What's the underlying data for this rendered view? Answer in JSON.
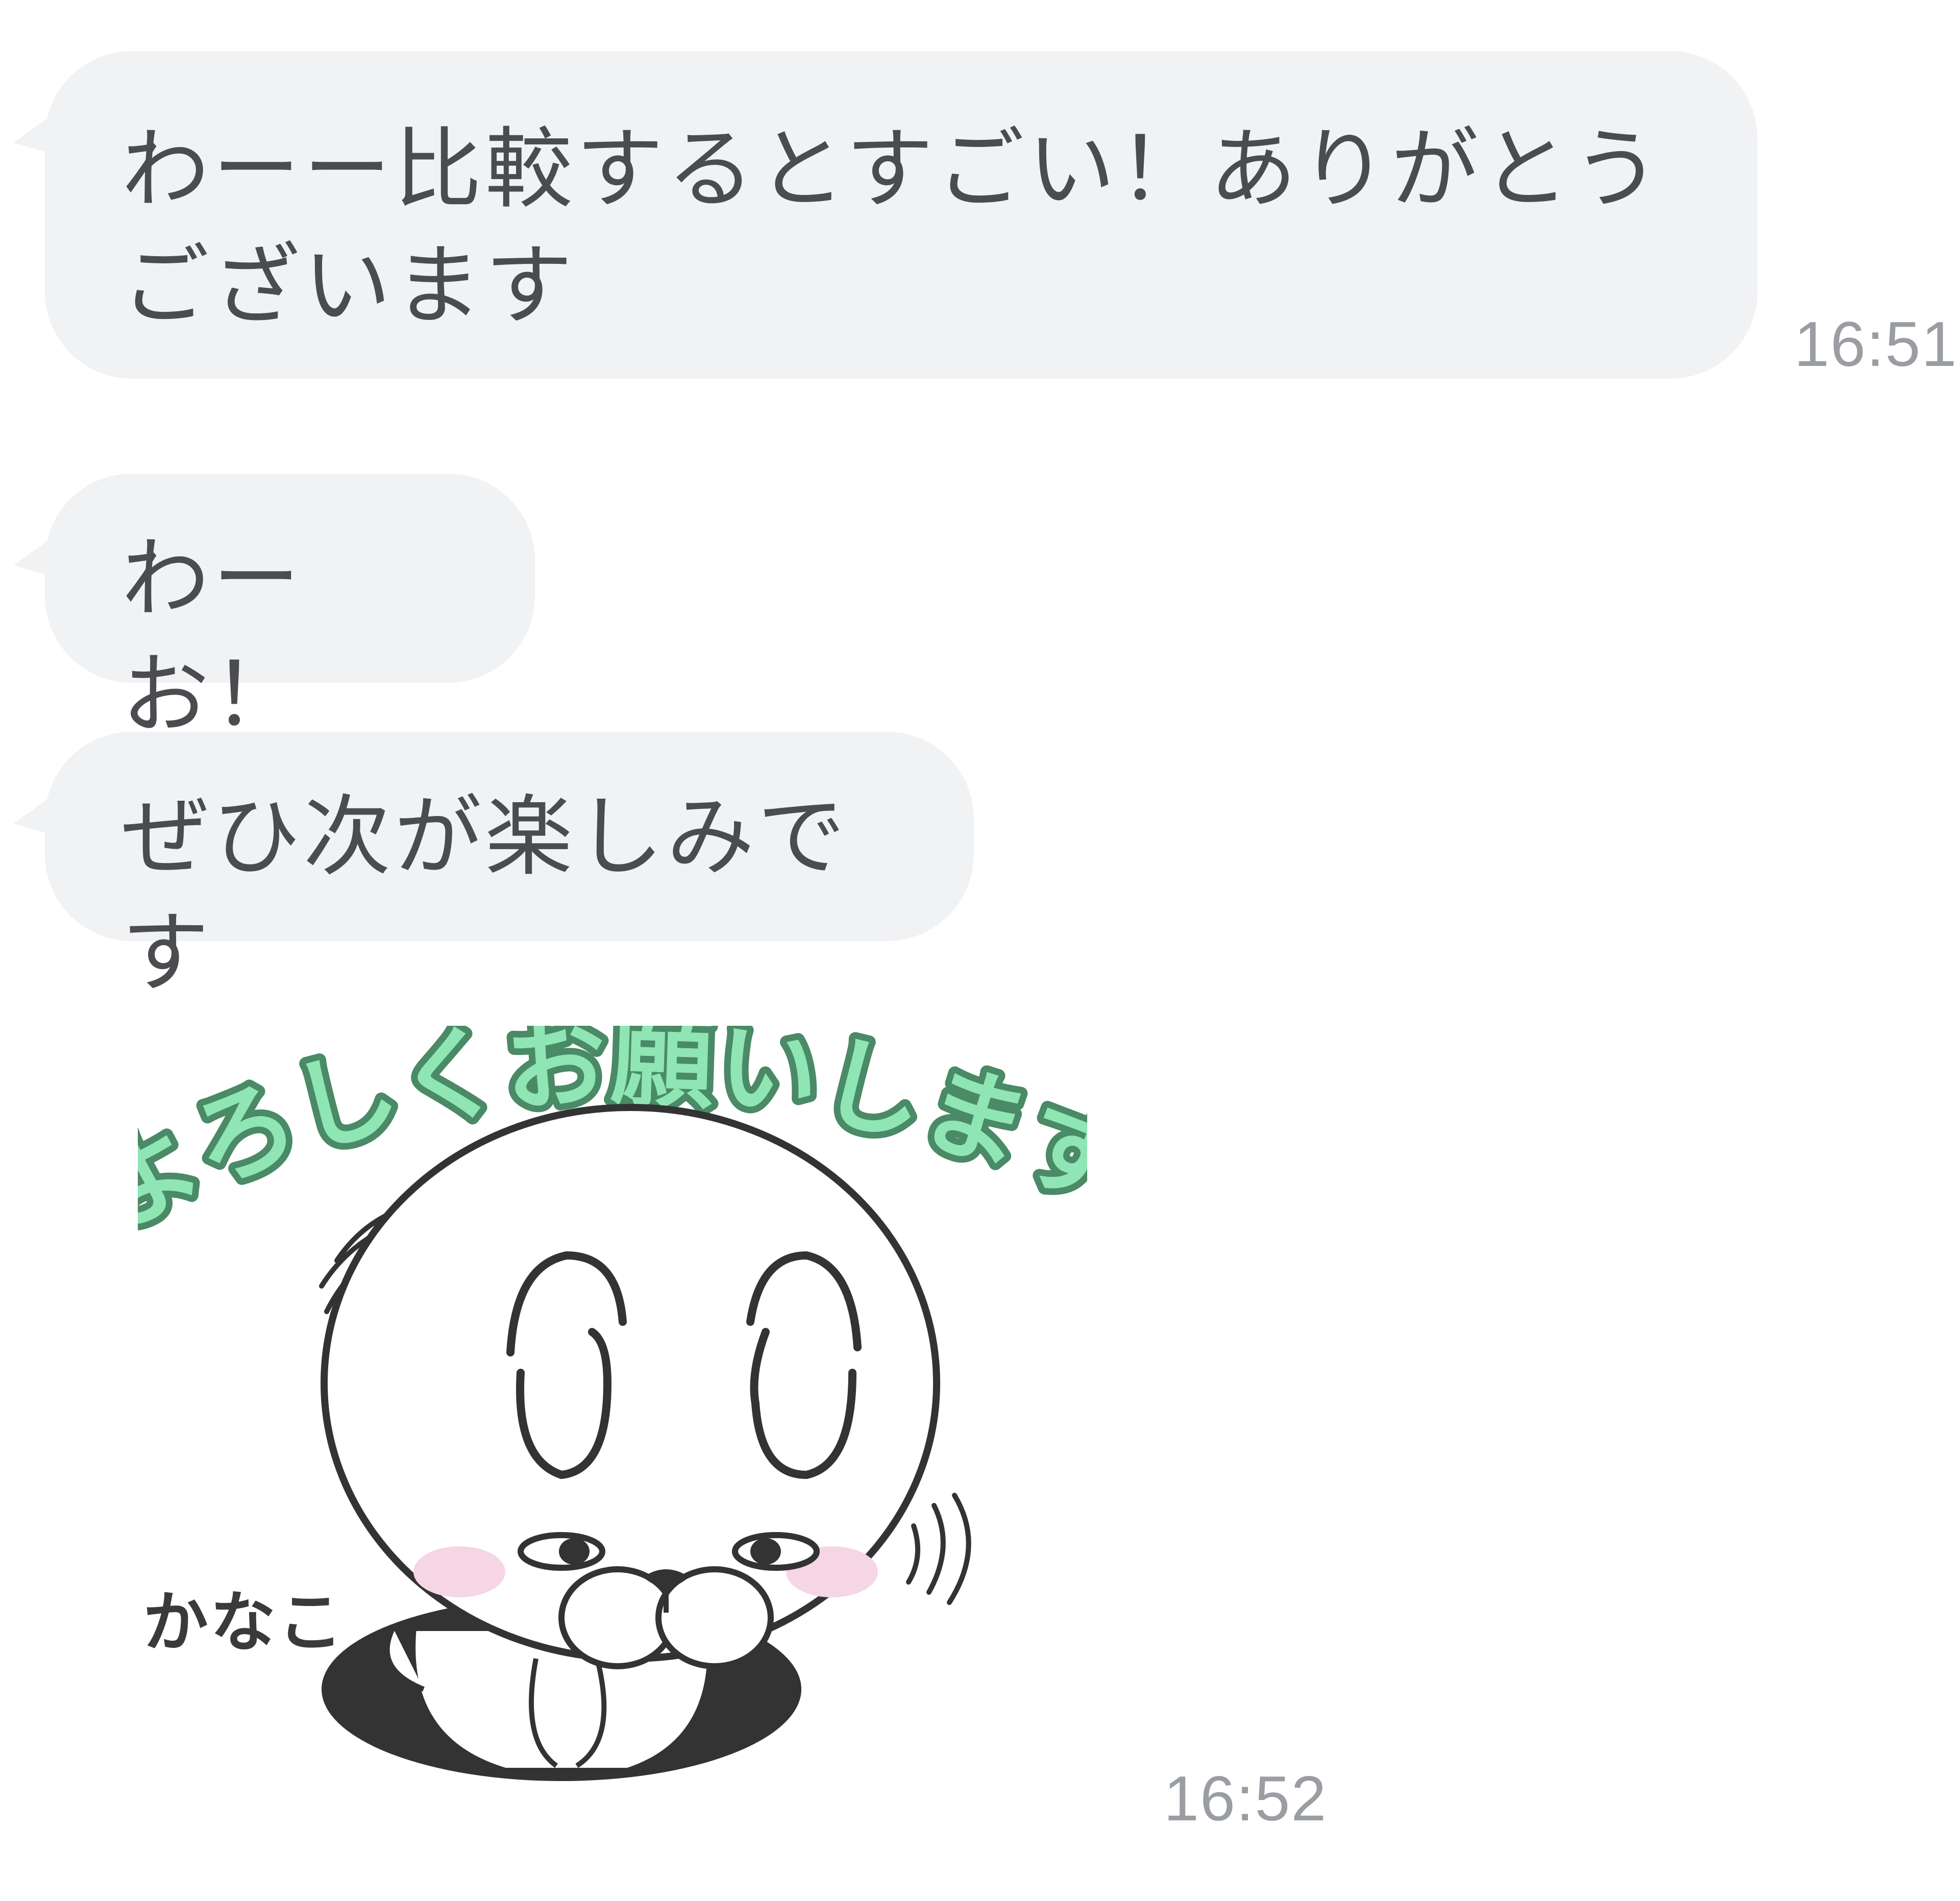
{
  "messages": [
    {
      "text": "わーー比較するとすごい！ありがとう\nございます",
      "time": "16:51"
    },
    {
      "text": "わーお！"
    },
    {
      "text": "ぜひ次が楽しみです"
    }
  ],
  "sticker": {
    "title": "よろしくお願いします",
    "name": "かなこ",
    "time": "16:52",
    "title_color": "#8fe6b4",
    "title_outline": "#4a8a66"
  },
  "colors": {
    "bubble_bg": "#f1f2f4",
    "bubble_text": "#4a4c50",
    "time_text": "#9a9ea3",
    "background": "#ffffff"
  }
}
